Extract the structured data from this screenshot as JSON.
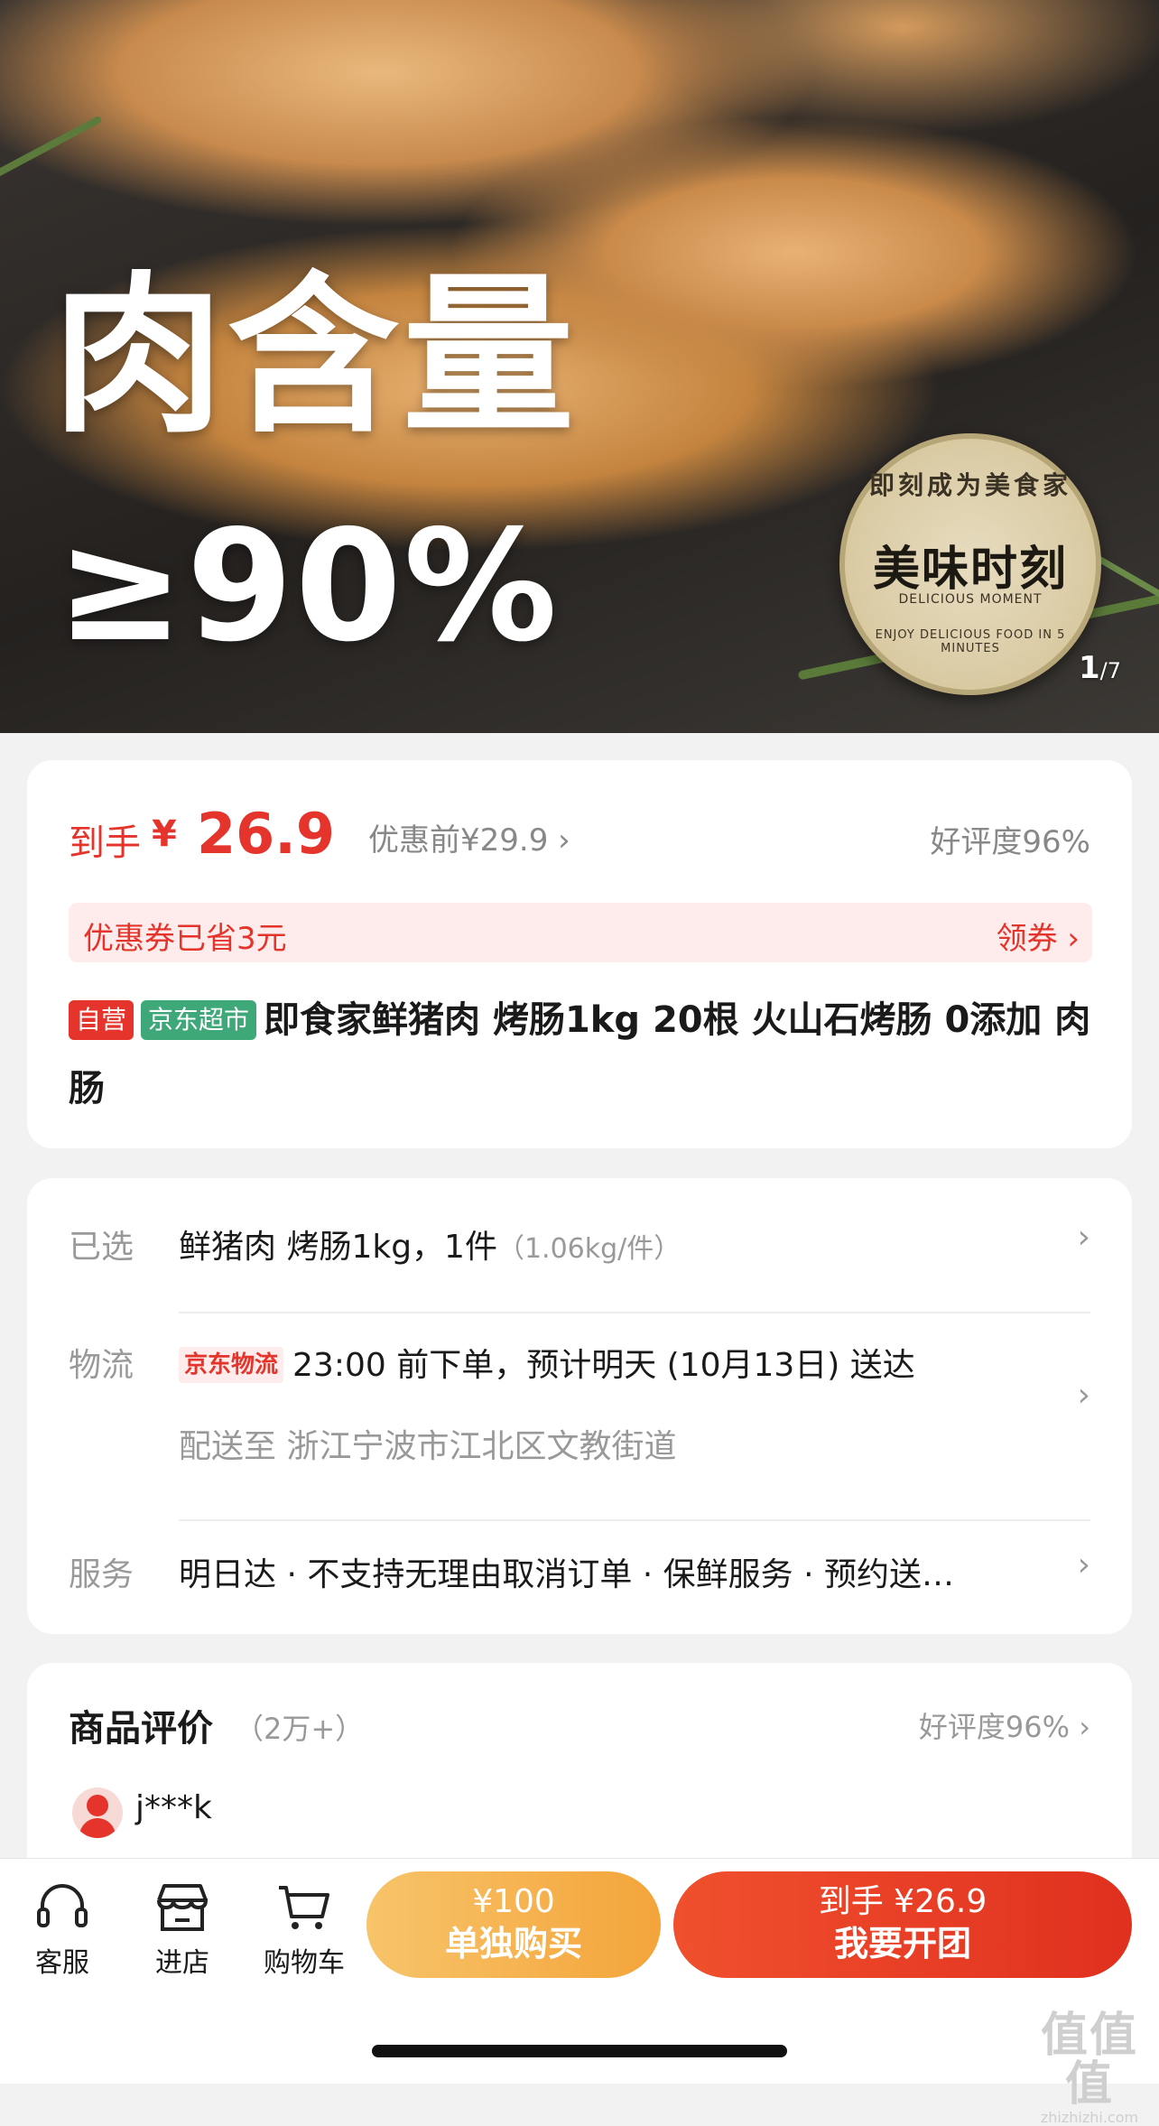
{
  "hero": {
    "headline_line1": "肉含量",
    "headline_line2": "≥90%",
    "seal_top": "即刻成为美食家",
    "seal_main": "美味时刻",
    "seal_sub": "DELICIOUS MOMENT",
    "seal_bottom": "ENJOY DELICIOUS FOOD IN 5 MINUTES",
    "pager_current": "1",
    "pager_total": "/7"
  },
  "price": {
    "label": "到手",
    "currency": "¥",
    "amount": "26.9",
    "original": "优惠前¥29.9 ›",
    "rating": "好评度96%"
  },
  "coupon": {
    "saved_text": "优惠券已省3元",
    "get_label": "领券 ›"
  },
  "product": {
    "tag_self": "自营",
    "tag_market": "京东超市",
    "title": "即食家鲜猪肉 烤肠1kg 20根 火山石烤肠 0添加 肉肠"
  },
  "selection": {
    "label": "已选",
    "value": "鲜猪肉 烤肠1kg，1件",
    "note": "（1.06kg/件）"
  },
  "logistics": {
    "label": "物流",
    "tag": "京东物流",
    "value": "23:00 前下单，预计明天 (10月13日) 送达",
    "address": "配送至 浙江宁波市江北区文教街道"
  },
  "service": {
    "label": "服务",
    "value": "明日达 · 不支持无理由取消订单 · 保鲜服务 · 预约送…"
  },
  "reviews": {
    "title": "商品评价",
    "count": "（2万+）",
    "rating": "好评度96% ›",
    "first_user": "j***k"
  },
  "bottom_bar": {
    "service_label": "客服",
    "store_label": "进店",
    "cart_label": "购物车",
    "single_price": "¥100",
    "single_label": "单独购买",
    "group_price": "到手 ¥26.9",
    "group_label": "我要开团"
  },
  "watermark": {
    "big": "值值值",
    "small": "zhizhizhi.com"
  },
  "colors": {
    "accent_red": "#e4342b",
    "tag_green": "#3ea878",
    "single_buy_orange": "#f4a43a"
  }
}
